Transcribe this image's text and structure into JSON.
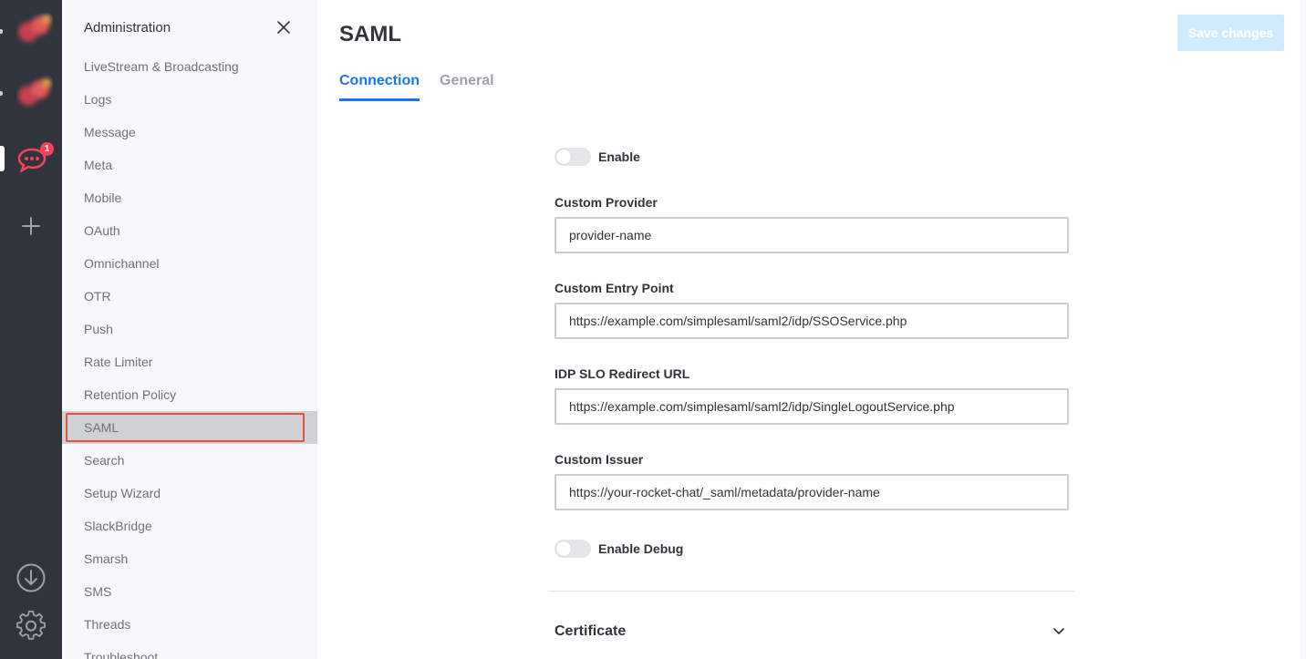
{
  "sidebar": {
    "title": "Administration",
    "items": [
      {
        "label": "LiveStream & Broadcasting"
      },
      {
        "label": "Logs"
      },
      {
        "label": "Message"
      },
      {
        "label": "Meta"
      },
      {
        "label": "Mobile"
      },
      {
        "label": "OAuth"
      },
      {
        "label": "Omnichannel"
      },
      {
        "label": "OTR"
      },
      {
        "label": "Push"
      },
      {
        "label": "Rate Limiter"
      },
      {
        "label": "Retention Policy"
      },
      {
        "label": "SAML"
      },
      {
        "label": "Search"
      },
      {
        "label": "Setup Wizard"
      },
      {
        "label": "SlackBridge"
      },
      {
        "label": "Smarsh"
      },
      {
        "label": "SMS"
      },
      {
        "label": "Threads"
      },
      {
        "label": "Troubleshoot"
      }
    ],
    "selected": "SAML"
  },
  "rail": {
    "notification_count": "1"
  },
  "main": {
    "title": "SAML",
    "save_label": "Save changes",
    "tabs": [
      {
        "label": "Connection",
        "active": true
      },
      {
        "label": "General",
        "active": false
      }
    ]
  },
  "form": {
    "enable_label": "Enable",
    "custom_provider_label": "Custom Provider",
    "custom_provider_value": "provider-name",
    "custom_entry_point_label": "Custom Entry Point",
    "custom_entry_point_value": "https://example.com/simplesaml/saml2/idp/SSOService.php",
    "idp_slo_label": "IDP SLO Redirect URL",
    "idp_slo_value": "https://example.com/simplesaml/saml2/idp/SingleLogoutService.php",
    "custom_issuer_label": "Custom Issuer",
    "custom_issuer_value": "https://your-rocket-chat/_saml/metadata/provider-name",
    "enable_debug_label": "Enable Debug",
    "certificate_section": "Certificate"
  },
  "colors": {
    "accent": "#1d74f5",
    "rail_bg": "#2f343d",
    "badge": "#f5455c",
    "highlight_border": "#e4513d"
  }
}
